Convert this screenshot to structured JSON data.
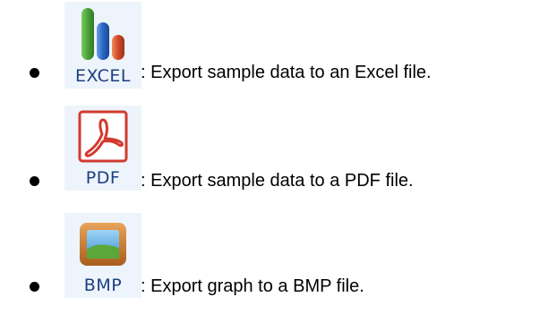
{
  "items": [
    {
      "icon": "excel-chart-icon",
      "label": "EXCEL",
      "description": ": Export sample data to an Excel file."
    },
    {
      "icon": "pdf-acrobat-icon",
      "label": "PDF",
      "description": ": Export sample data to a PDF file."
    },
    {
      "icon": "bmp-image-icon",
      "label": "BMP",
      "description": ": Export graph to a BMP file."
    }
  ],
  "colors": {
    "label": "#1c3f82",
    "button_bg": "#eef4fb",
    "excel_green": "#4aa23b",
    "excel_blue": "#2a66c4",
    "excel_red": "#d14a2a",
    "pdf_red": "#d23a2f",
    "bmp_frame": "#c97a2a",
    "bmp_sky": "#5fb0e6",
    "bmp_grass": "#5aa83a"
  }
}
